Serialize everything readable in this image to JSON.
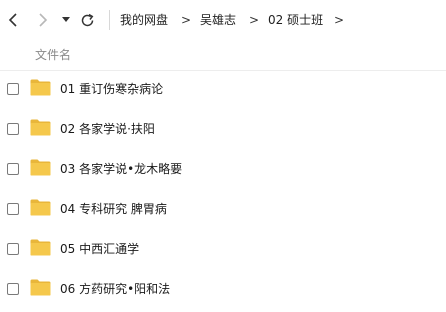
{
  "breadcrumb": {
    "items": [
      "我的网盘",
      "吴雄志",
      "02 硕士班"
    ],
    "separator": ">"
  },
  "header": {
    "column_name": "文件名"
  },
  "files": [
    {
      "name": "01 重订伤寒杂病论",
      "icon": "folder-icon"
    },
    {
      "name": "02 各家学说·扶阳",
      "icon": "folder-icon"
    },
    {
      "name": "03 各家学说•龙木略要",
      "icon": "folder-icon"
    },
    {
      "name": "04 专科研究 脾胃病",
      "icon": "folder-icon"
    },
    {
      "name": "05 中西汇通学",
      "icon": "folder-icon"
    },
    {
      "name": "06 方药研究•阳和法",
      "icon": "folder-icon"
    }
  ],
  "colors": {
    "folder": "#f5c84c",
    "folder_tab": "#e9b63a"
  }
}
